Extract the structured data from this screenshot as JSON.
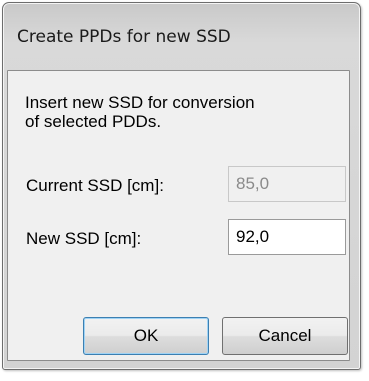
{
  "dialog": {
    "title": "Create PPDs for new SSD",
    "description_line1": "Insert new SSD for conversion",
    "description_line2": "of selected PDDs."
  },
  "fields": {
    "current_ssd_label": "Current SSD [cm]:",
    "current_ssd_value": "85,0",
    "new_ssd_label": "New SSD [cm]:",
    "new_ssd_value": "92,0"
  },
  "buttons": {
    "ok_label": "OK",
    "cancel_label": "Cancel"
  }
}
